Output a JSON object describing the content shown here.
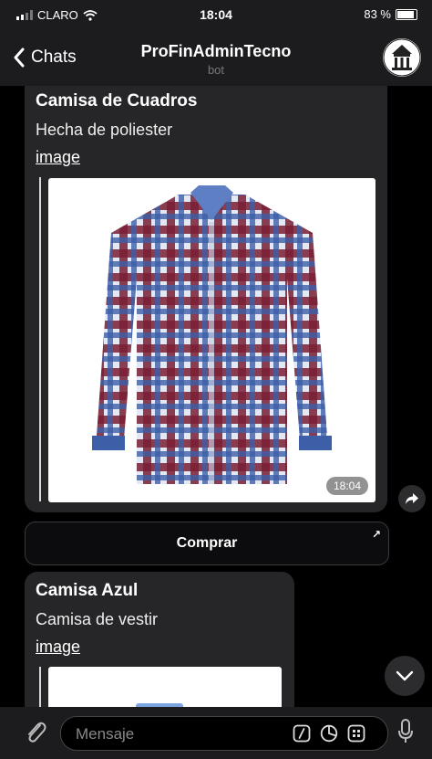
{
  "status_bar": {
    "carrier": "CLARO",
    "time": "18:04",
    "battery": "83 %"
  },
  "header": {
    "back_label": "Chats",
    "title": "ProFinAdminTecno",
    "subtitle": "bot"
  },
  "messages": [
    {
      "title": "Camisa de Cuadros",
      "description": "Hecha de poliester",
      "link": "image",
      "time": "18:04"
    },
    {
      "title": "Camisa Azul",
      "description": "Camisa de vestir",
      "link": "image"
    }
  ],
  "buy_button": {
    "label": "Comprar",
    "arrow": "↗"
  },
  "input": {
    "placeholder": "Mensaje"
  },
  "icons": {
    "attach": "paperclip-icon",
    "command": "slash-command-icon",
    "sticker": "sticker-icon",
    "keyboard": "bot-keyboard-icon",
    "mic": "microphone-icon",
    "share": "share-icon",
    "scroll": "chevron-down-icon"
  },
  "colors": {
    "background": "#000000",
    "bubble": "#262628",
    "bar": "#1c1c1e",
    "shirt_red": "#7a1f35",
    "shirt_blue": "#3c5fa8"
  }
}
